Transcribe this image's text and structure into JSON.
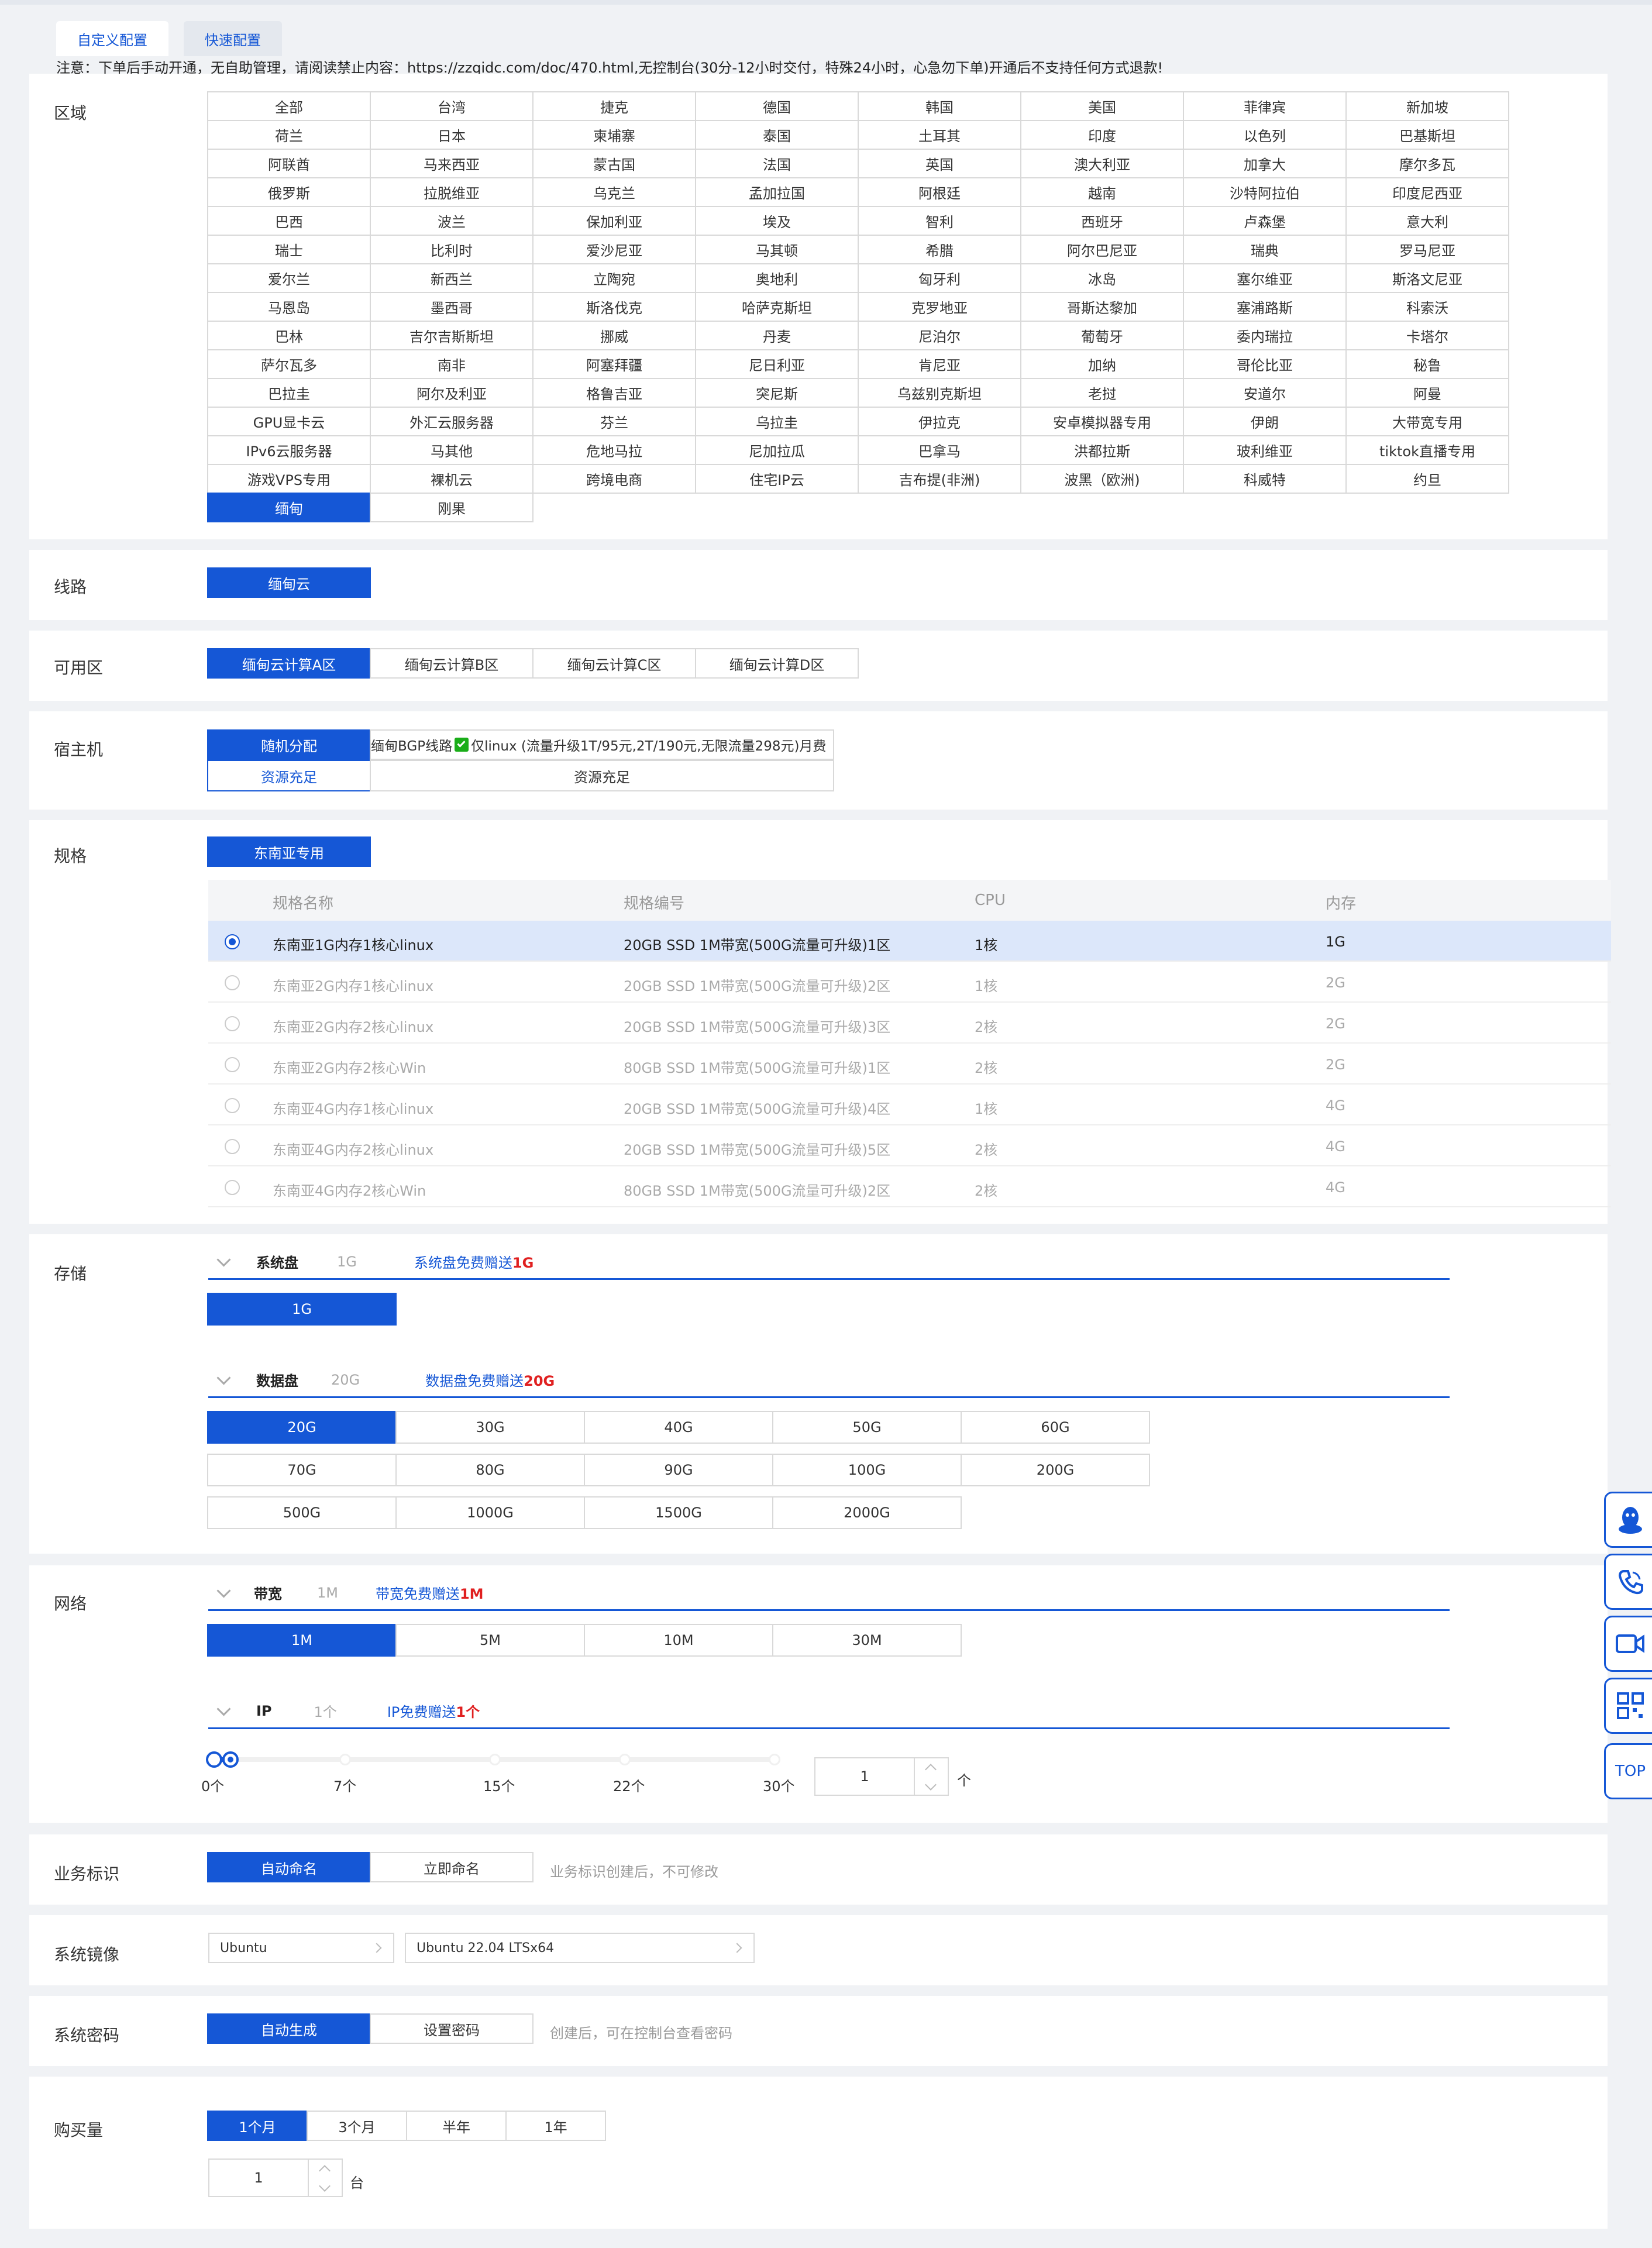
{
  "tabs": [
    {
      "label": "自定义配置",
      "active": true
    },
    {
      "label": "快速配置",
      "active": false
    }
  ],
  "notice": "注意：下单后手动开通，无自助管理，请阅读禁止内容：https://zzqidc.com/doc/470.html,无控制台(30分-12小时交付，特殊24小时，心急勿下单)开通后不支持任何方式退款!",
  "region": {
    "label": "区域",
    "selected": "缅甸",
    "items": [
      "全部",
      "台湾",
      "捷克",
      "德国",
      "韩国",
      "美国",
      "菲律宾",
      "新加坡",
      "荷兰",
      "日本",
      "柬埔寨",
      "泰国",
      "土耳其",
      "印度",
      "以色列",
      "巴基斯坦",
      "阿联酋",
      "马来西亚",
      "蒙古国",
      "法国",
      "英国",
      "澳大利亚",
      "加拿大",
      "摩尔多瓦",
      "俄罗斯",
      "拉脱维亚",
      "乌克兰",
      "孟加拉国",
      "阿根廷",
      "越南",
      "沙特阿拉伯",
      "印度尼西亚",
      "巴西",
      "波兰",
      "保加利亚",
      "埃及",
      "智利",
      "西班牙",
      "卢森堡",
      "意大利",
      "瑞士",
      "比利时",
      "爱沙尼亚",
      "马其顿",
      "希腊",
      "阿尔巴尼亚",
      "瑞典",
      "罗马尼亚",
      "爱尔兰",
      "新西兰",
      "立陶宛",
      "奥地利",
      "匈牙利",
      "冰岛",
      "塞尔维亚",
      "斯洛文尼亚",
      "马恩岛",
      "墨西哥",
      "斯洛伐克",
      "哈萨克斯坦",
      "克罗地亚",
      "哥斯达黎加",
      "塞浦路斯",
      "科索沃",
      "巴林",
      "吉尔吉斯斯坦",
      "挪威",
      "丹麦",
      "尼泊尔",
      "葡萄牙",
      "委内瑞拉",
      "卡塔尔",
      "萨尔瓦多",
      "南非",
      "阿塞拜疆",
      "尼日利亚",
      "肯尼亚",
      "加纳",
      "哥伦比亚",
      "秘鲁",
      "巴拉圭",
      "阿尔及利亚",
      "格鲁吉亚",
      "突尼斯",
      "乌兹别克斯坦",
      "老挝",
      "安道尔",
      "阿曼",
      "GPU显卡云",
      "外汇云服务器",
      "芬兰",
      "乌拉圭",
      "伊拉克",
      "安卓模拟器专用",
      "伊朗",
      "大带宽专用",
      "IPv6云服务器",
      "马其他",
      "危地马拉",
      "尼加拉瓜",
      "巴拿马",
      "洪都拉斯",
      "玻利维亚",
      "tiktok直播专用",
      "游戏VPS专用",
      "裸机云",
      "跨境电商",
      "住宅IP云",
      "吉布提(非洲)",
      "波黑（欧洲)",
      "科威特",
      "约旦",
      "缅甸",
      "刚果"
    ]
  },
  "line": {
    "label": "线路",
    "items": [
      "缅甸云"
    ],
    "selected": "缅甸云"
  },
  "zone": {
    "label": "可用区",
    "items": [
      "缅甸云计算A区",
      "缅甸云计算B区",
      "缅甸云计算C区",
      "缅甸云计算D区"
    ],
    "selected": "缅甸云计算A区"
  },
  "host": {
    "label": "宿主机",
    "random_label": "随机分配",
    "random_status": "资源充足",
    "option_label": "缅甸BGP线路",
    "option_desc": "仅linux (流量升级1T/95元,2T/190元,无限流量298元)月费",
    "option_status": "资源充足",
    "check_color": "#1aad19"
  },
  "spec": {
    "label": "规格",
    "group": "东南亚专用",
    "columns": [
      "规格名称",
      "规格编号",
      "CPU",
      "内存"
    ],
    "rows": [
      {
        "name": "东南亚1G内存1核心linux",
        "code": "20GB SSD 1M带宽(500G流量可升级)1区",
        "cpu": "1核",
        "mem": "1G",
        "selected": true
      },
      {
        "name": "东南亚2G内存1核心linux",
        "code": "20GB SSD 1M带宽(500G流量可升级)2区",
        "cpu": "1核",
        "mem": "2G",
        "selected": false
      },
      {
        "name": "东南亚2G内存2核心linux",
        "code": "20GB SSD 1M带宽(500G流量可升级)3区",
        "cpu": "2核",
        "mem": "2G",
        "selected": false
      },
      {
        "name": "东南亚2G内存2核心Win",
        "code": "80GB SSD 1M带宽(500G流量可升级)1区",
        "cpu": "2核",
        "mem": "2G",
        "selected": false
      },
      {
        "name": "东南亚4G内存1核心linux",
        "code": "20GB SSD 1M带宽(500G流量可升级)4区",
        "cpu": "1核",
        "mem": "4G",
        "selected": false
      },
      {
        "name": "东南亚4G内存2核心linux",
        "code": "20GB SSD 1M带宽(500G流量可升级)5区",
        "cpu": "2核",
        "mem": "4G",
        "selected": false
      },
      {
        "name": "东南亚4G内存2核心Win",
        "code": "80GB SSD 1M带宽(500G流量可升级)2区",
        "cpu": "2核",
        "mem": "4G",
        "selected": false
      }
    ]
  },
  "storage": {
    "label": "存储",
    "system": {
      "name": "系统盘",
      "value": "1G",
      "gift_prefix": "系统盘免费赠送",
      "gift_value": "1G",
      "options": [
        "1G"
      ],
      "selected": "1G"
    },
    "data": {
      "name": "数据盘",
      "value": "20G",
      "gift_prefix": "数据盘免费赠送",
      "gift_value": "20G",
      "options": [
        "20G",
        "30G",
        "40G",
        "50G",
        "60G",
        "70G",
        "80G",
        "90G",
        "100G",
        "200G",
        "500G",
        "1000G",
        "1500G",
        "2000G"
      ],
      "selected": "20G"
    }
  },
  "network": {
    "label": "网络",
    "bandwidth": {
      "name": "带宽",
      "value": "1M",
      "gift_prefix": "带宽免费赠送",
      "gift_value": "1M",
      "options": [
        "1M",
        "5M",
        "10M",
        "30M"
      ],
      "selected": "1M"
    },
    "ip": {
      "name": "IP",
      "value": "1个",
      "gift_prefix": "IP免费赠送",
      "gift_value": "1个",
      "ticks": [
        "0个",
        "7个",
        "15个",
        "22个",
        "30个"
      ],
      "min": 0,
      "max": 30,
      "current": 1,
      "input": "1",
      "unit": "个"
    }
  },
  "business": {
    "label": "业务标识",
    "items": [
      "自动命名",
      "立即命名"
    ],
    "selected": "自动命名",
    "hint": "业务标识创建后，不可修改"
  },
  "image": {
    "label": "系统镜像",
    "os": "Ubuntu",
    "version": "Ubuntu 22.04 LTSx64"
  },
  "password": {
    "label": "系统密码",
    "items": [
      "自动生成",
      "设置密码"
    ],
    "selected": "自动生成",
    "hint": "创建后，可在控制台查看密码"
  },
  "purchase": {
    "label": "购买量",
    "items": [
      "1个月",
      "3个月",
      "半年",
      "1年"
    ],
    "selected": "1个月",
    "qty": "1",
    "unit": "台"
  },
  "side": {
    "top_label": "TOP"
  }
}
